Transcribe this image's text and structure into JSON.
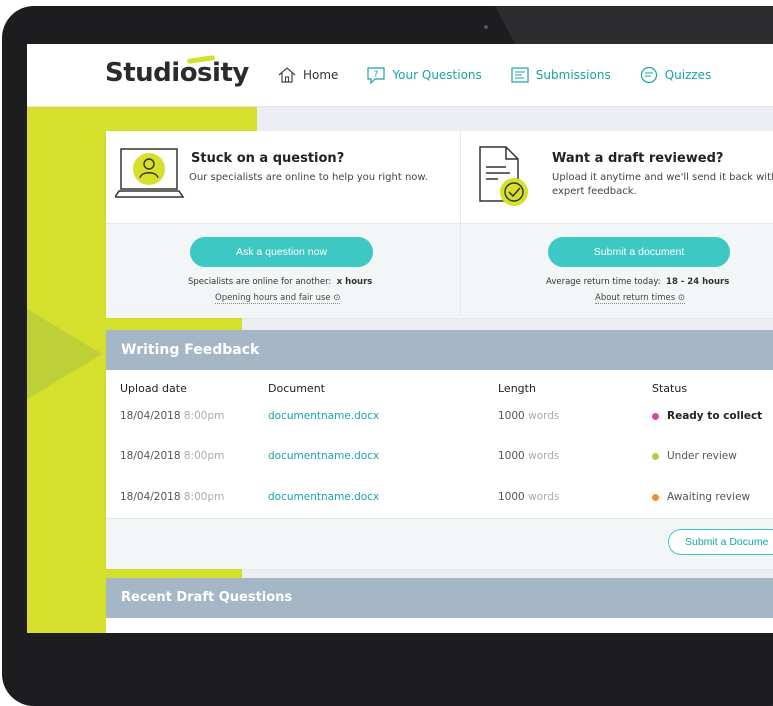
{
  "brand": {
    "logo_text": "Studiosity",
    "accent": "#3ec8c4",
    "lime": "#d4e02b"
  },
  "nav": {
    "items": [
      {
        "label": "Home",
        "icon": "home-icon"
      },
      {
        "label": "Your Questions",
        "icon": "question-icon"
      },
      {
        "label": "Submissions",
        "icon": "submissions-icon"
      },
      {
        "label": "Quizzes",
        "icon": "quizzes-icon"
      }
    ]
  },
  "promo": {
    "question": {
      "title": "Stuck on a question?",
      "desc": "Our specialists are online to help you right now.",
      "button": "Ask a question now",
      "info_prefix": "Specialists are online for another:",
      "info_value": "x hours",
      "link": "Opening hours and fair use"
    },
    "draft": {
      "title": "Want a draft reviewed?",
      "desc_line1": "Upload it anytime and we'll send it back with",
      "desc_line2": "expert feedback.",
      "button": "Submit a document",
      "info_prefix": "Average return time today:",
      "info_value": "18 - 24 hours",
      "link": "About return times"
    }
  },
  "writing_feedback": {
    "title": "Writing Feedback",
    "columns": [
      "Upload date",
      "Document",
      "Length",
      "Status"
    ],
    "rows": [
      {
        "date": "18/04/2018",
        "time": "8:00pm",
        "document": "documentname.docx",
        "length": "1000",
        "unit": "words",
        "status": "Ready to collect",
        "status_color": "#e040a0"
      },
      {
        "date": "18/04/2018",
        "time": "8:00pm",
        "document": "documentname.docx",
        "length": "1000",
        "unit": "words",
        "status": "Under review",
        "status_color": "#b6cc3b"
      },
      {
        "date": "18/04/2018",
        "time": "8:00pm",
        "document": "documentname.docx",
        "length": "1000",
        "unit": "words",
        "status": "Awaiting review",
        "status_color": "#f08c30"
      }
    ],
    "footer_button": "Submit a Docume"
  },
  "recent_drafts": {
    "title": "Recent Draft Questions"
  }
}
